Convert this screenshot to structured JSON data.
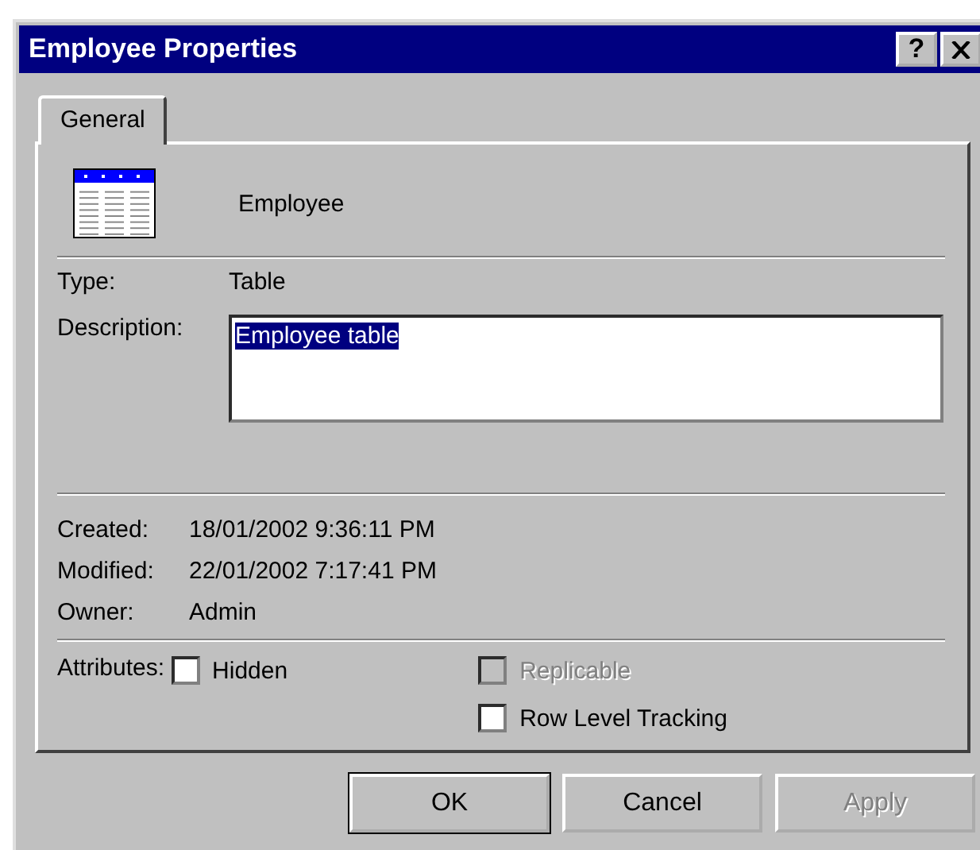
{
  "window": {
    "title": "Employee Properties",
    "help_button": "?"
  },
  "tabs": [
    {
      "label": "General",
      "selected": true
    }
  ],
  "object": {
    "name": "Employee"
  },
  "type": {
    "label": "Type:",
    "value": "Table"
  },
  "description": {
    "label": "Description:",
    "value": "Employee table",
    "text_selected": true
  },
  "dates": [
    {
      "label": "Created:",
      "value": "18/01/2002 9:36:11 PM"
    },
    {
      "label": "Modified:",
      "value": "22/01/2002 7:17:41 PM"
    },
    {
      "label": "Owner:",
      "value": "Admin"
    }
  ],
  "attributes": {
    "label": "Attributes:",
    "options": [
      {
        "label": "Hidden",
        "checked": false,
        "disabled": false
      },
      {
        "label": "Replicable",
        "checked": false,
        "disabled": true
      },
      {
        "label": "Row Level Tracking",
        "checked": false,
        "disabled": false
      }
    ]
  },
  "buttons": [
    {
      "label": "OK",
      "default": true,
      "disabled": false
    },
    {
      "label": "Cancel",
      "default": false,
      "disabled": false
    },
    {
      "label": "Apply",
      "default": false,
      "disabled": true
    }
  ]
}
